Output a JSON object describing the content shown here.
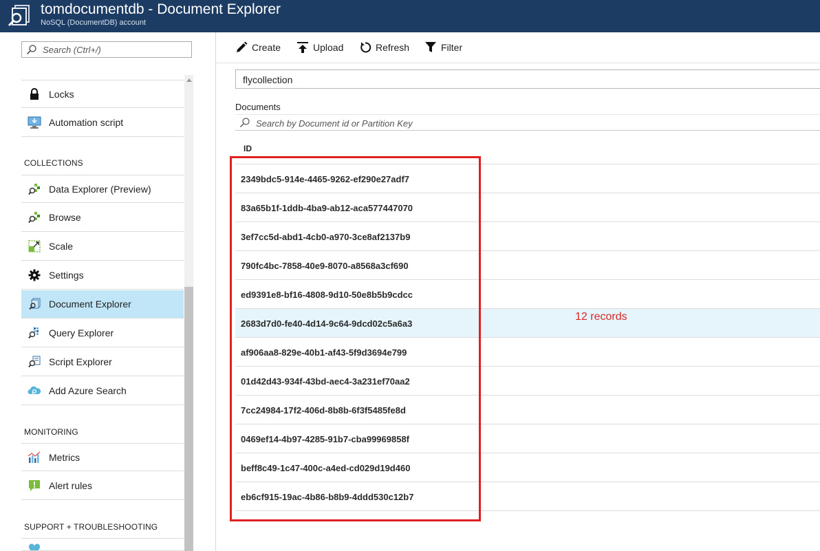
{
  "app": {
    "title": "tomdocumentdb - Document Explorer",
    "subtitle": "NoSQL (DocumentDB) account",
    "icon": "document-explorer-app-icon"
  },
  "sidebar": {
    "search_placeholder": "Search (Ctrl+/)",
    "items_top": [
      {
        "label": "Locks",
        "icon": "lock-icon"
      },
      {
        "label": "Automation script",
        "icon": "automation-script-icon"
      }
    ],
    "sections": {
      "collections": "COLLECTIONS",
      "monitoring": "MONITORING",
      "support": "SUPPORT + TROUBLESHOOTING"
    },
    "collections_items": [
      {
        "label": "Data Explorer (Preview)",
        "icon": "data-explorer-icon"
      },
      {
        "label": "Browse",
        "icon": "browse-icon"
      },
      {
        "label": "Scale",
        "icon": "scale-icon"
      },
      {
        "label": "Settings",
        "icon": "gear-icon"
      },
      {
        "label": "Document Explorer",
        "icon": "document-explorer-icon",
        "active": true
      },
      {
        "label": "Query Explorer",
        "icon": "query-explorer-icon"
      },
      {
        "label": "Script Explorer",
        "icon": "script-explorer-icon"
      },
      {
        "label": "Add Azure Search",
        "icon": "cloud-search-icon"
      }
    ],
    "monitoring_items": [
      {
        "label": "Metrics",
        "icon": "metrics-chart-icon"
      },
      {
        "label": "Alert rules",
        "icon": "alert-icon"
      }
    ]
  },
  "toolbar": {
    "create": "Create",
    "upload": "Upload",
    "refresh": "Refresh",
    "filter": "Filter"
  },
  "collection": {
    "selected": "flycollection"
  },
  "documents": {
    "label": "Documents",
    "search_placeholder": "Search by Document id or Partition Key",
    "column_header": "ID",
    "rows": [
      "2349bdc5-914e-4465-9262-ef290e27adf7",
      "83a65b1f-1ddb-4ba9-ab12-aca577447070",
      "3ef7cc5d-abd1-4cb0-a970-3ce8af2137b9",
      "790fc4bc-7858-40e9-8070-a8568a3cf690",
      "ed9391e8-bf16-4808-9d10-50e8b5b9cdcc",
      "2683d7d0-fe40-4d14-9c64-9dcd02c5a6a3",
      "af906aa8-829e-40b1-af43-5f9d3694e799",
      "01d42d43-934f-43bd-aec4-3a231ef70aa2",
      "7cc24984-17f2-406d-8b8b-6f3f5485fe8d",
      "0469ef14-4b97-4285-91b7-cba99969858f",
      "beff8c49-1c47-400c-a4ed-cd029d19d460",
      "eb6cf915-19ac-4b86-b8b9-4ddd530c12b7"
    ],
    "selected_index": 5
  },
  "annotation": {
    "text": "12 records",
    "color": "#d62828"
  },
  "colors": {
    "header_bg": "#1d3c63",
    "active_menu_bg": "#c1e6f8",
    "selected_row_bg": "#e5f5fb",
    "highlight_box": "#e02020"
  }
}
